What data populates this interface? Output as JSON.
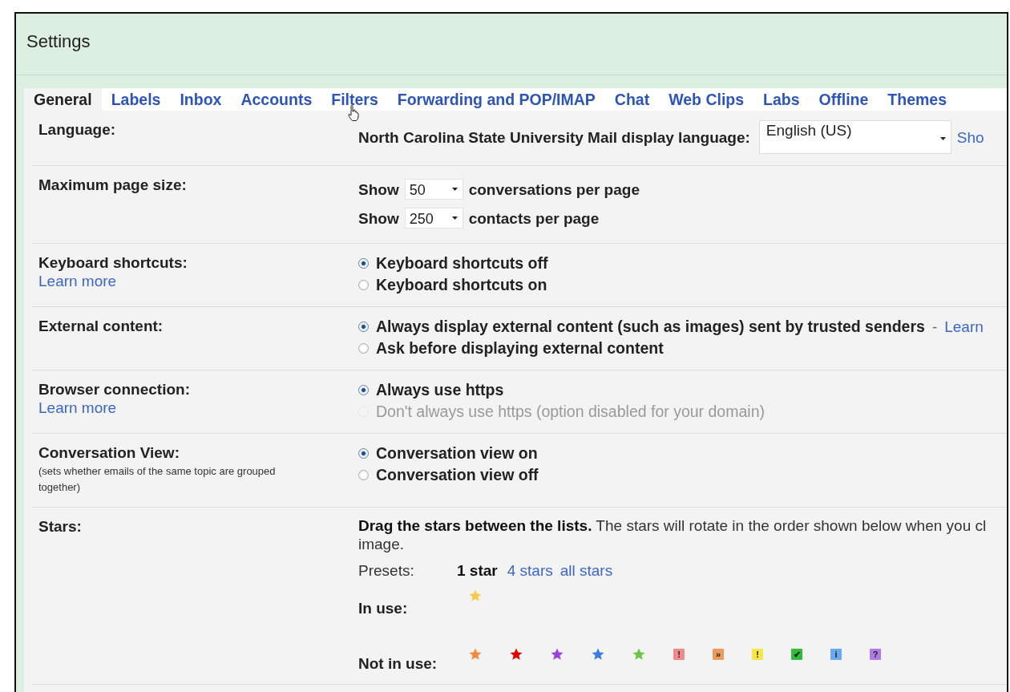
{
  "window": {
    "title": "Settings"
  },
  "tabs": [
    {
      "label": "General",
      "selected": true
    },
    {
      "label": "Labels",
      "selected": false
    },
    {
      "label": "Inbox",
      "selected": false
    },
    {
      "label": "Accounts",
      "selected": false
    },
    {
      "label": "Filters",
      "selected": false
    },
    {
      "label": "Forwarding and POP/IMAP",
      "selected": false
    },
    {
      "label": "Chat",
      "selected": false
    },
    {
      "label": "Web Clips",
      "selected": false
    },
    {
      "label": "Labs",
      "selected": false
    },
    {
      "label": "Offline",
      "selected": false
    },
    {
      "label": "Themes",
      "selected": false
    }
  ],
  "settings": [
    {
      "kind": "language",
      "label": "Language:",
      "text": "North Carolina State University Mail display language:",
      "select": "English (US)",
      "link": "Sho"
    },
    {
      "kind": "pagesize",
      "label": "Maximum page size:",
      "lines": [
        {
          "prefix": "Show",
          "select": "50",
          "suffix": "conversations per page"
        },
        {
          "prefix": "Show",
          "select": "250",
          "suffix": "contacts per page"
        }
      ]
    },
    {
      "kind": "radio",
      "label": "Keyboard shortcuts:",
      "link": "Learn more",
      "options": [
        {
          "text": "Keyboard shortcuts off",
          "selected": true,
          "disabled": false
        },
        {
          "text": "Keyboard shortcuts on",
          "selected": false,
          "disabled": false
        }
      ]
    },
    {
      "kind": "radio",
      "label": "External content:",
      "options": [
        {
          "text": "Always display external content (such as images) sent by trusted senders",
          "selected": true,
          "disabled": false,
          "after": "-",
          "link": "Learn"
        },
        {
          "text": "Ask before displaying external content",
          "selected": false,
          "disabled": false
        }
      ]
    },
    {
      "kind": "radio",
      "label": "Browser connection:",
      "link": "Learn more",
      "options": [
        {
          "text": "Always use https",
          "selected": true,
          "disabled": false
        },
        {
          "text": "Don't always use https (option disabled for your domain)",
          "selected": false,
          "disabled": true
        }
      ]
    },
    {
      "kind": "radio",
      "label": "Conversation View:",
      "note": "(sets whether emails of the same topic are grouped together)",
      "options": [
        {
          "text": "Conversation view on",
          "selected": true,
          "disabled": false
        },
        {
          "text": "Conversation view off",
          "selected": false,
          "disabled": false
        }
      ]
    },
    {
      "kind": "stars",
      "label": "Stars:",
      "instruction": "**Drag the stars between the lists.**  The stars will rotate in the order shown below when you cl",
      "instruction_end": "image.",
      "presets_label": "Presets:",
      "presets": [
        {
          "label": "1 star",
          "selected": true
        },
        {
          "label": "4 stars",
          "selected": false
        },
        {
          "label": "all stars",
          "selected": false
        }
      ],
      "in_use_label": "In use:",
      "in_use": [
        {
          "kind": "star",
          "color": "#f9c94e"
        }
      ],
      "not_in_use_label": "Not in use:",
      "not_in_use": [
        {
          "kind": "star",
          "color": "#f4883b"
        },
        {
          "kind": "star",
          "color": "#e00000"
        },
        {
          "kind": "star",
          "color": "#9a3fe0"
        },
        {
          "kind": "star",
          "color": "#3a7be0"
        },
        {
          "kind": "star",
          "color": "#6cc644"
        },
        {
          "kind": "badge",
          "color": "#f08a8a",
          "symbol": "!"
        },
        {
          "kind": "badge",
          "color": "#ef9b5b",
          "symbol": "»"
        },
        {
          "kind": "badge",
          "color": "#f5e74a",
          "symbol": "!"
        },
        {
          "kind": "badge",
          "color": "#2fbb3b",
          "symbol": "✔"
        },
        {
          "kind": "badge",
          "color": "#6aa9ed",
          "symbol": "i"
        },
        {
          "kind": "badge",
          "color": "#b07ae8",
          "symbol": "?"
        }
      ]
    }
  ]
}
